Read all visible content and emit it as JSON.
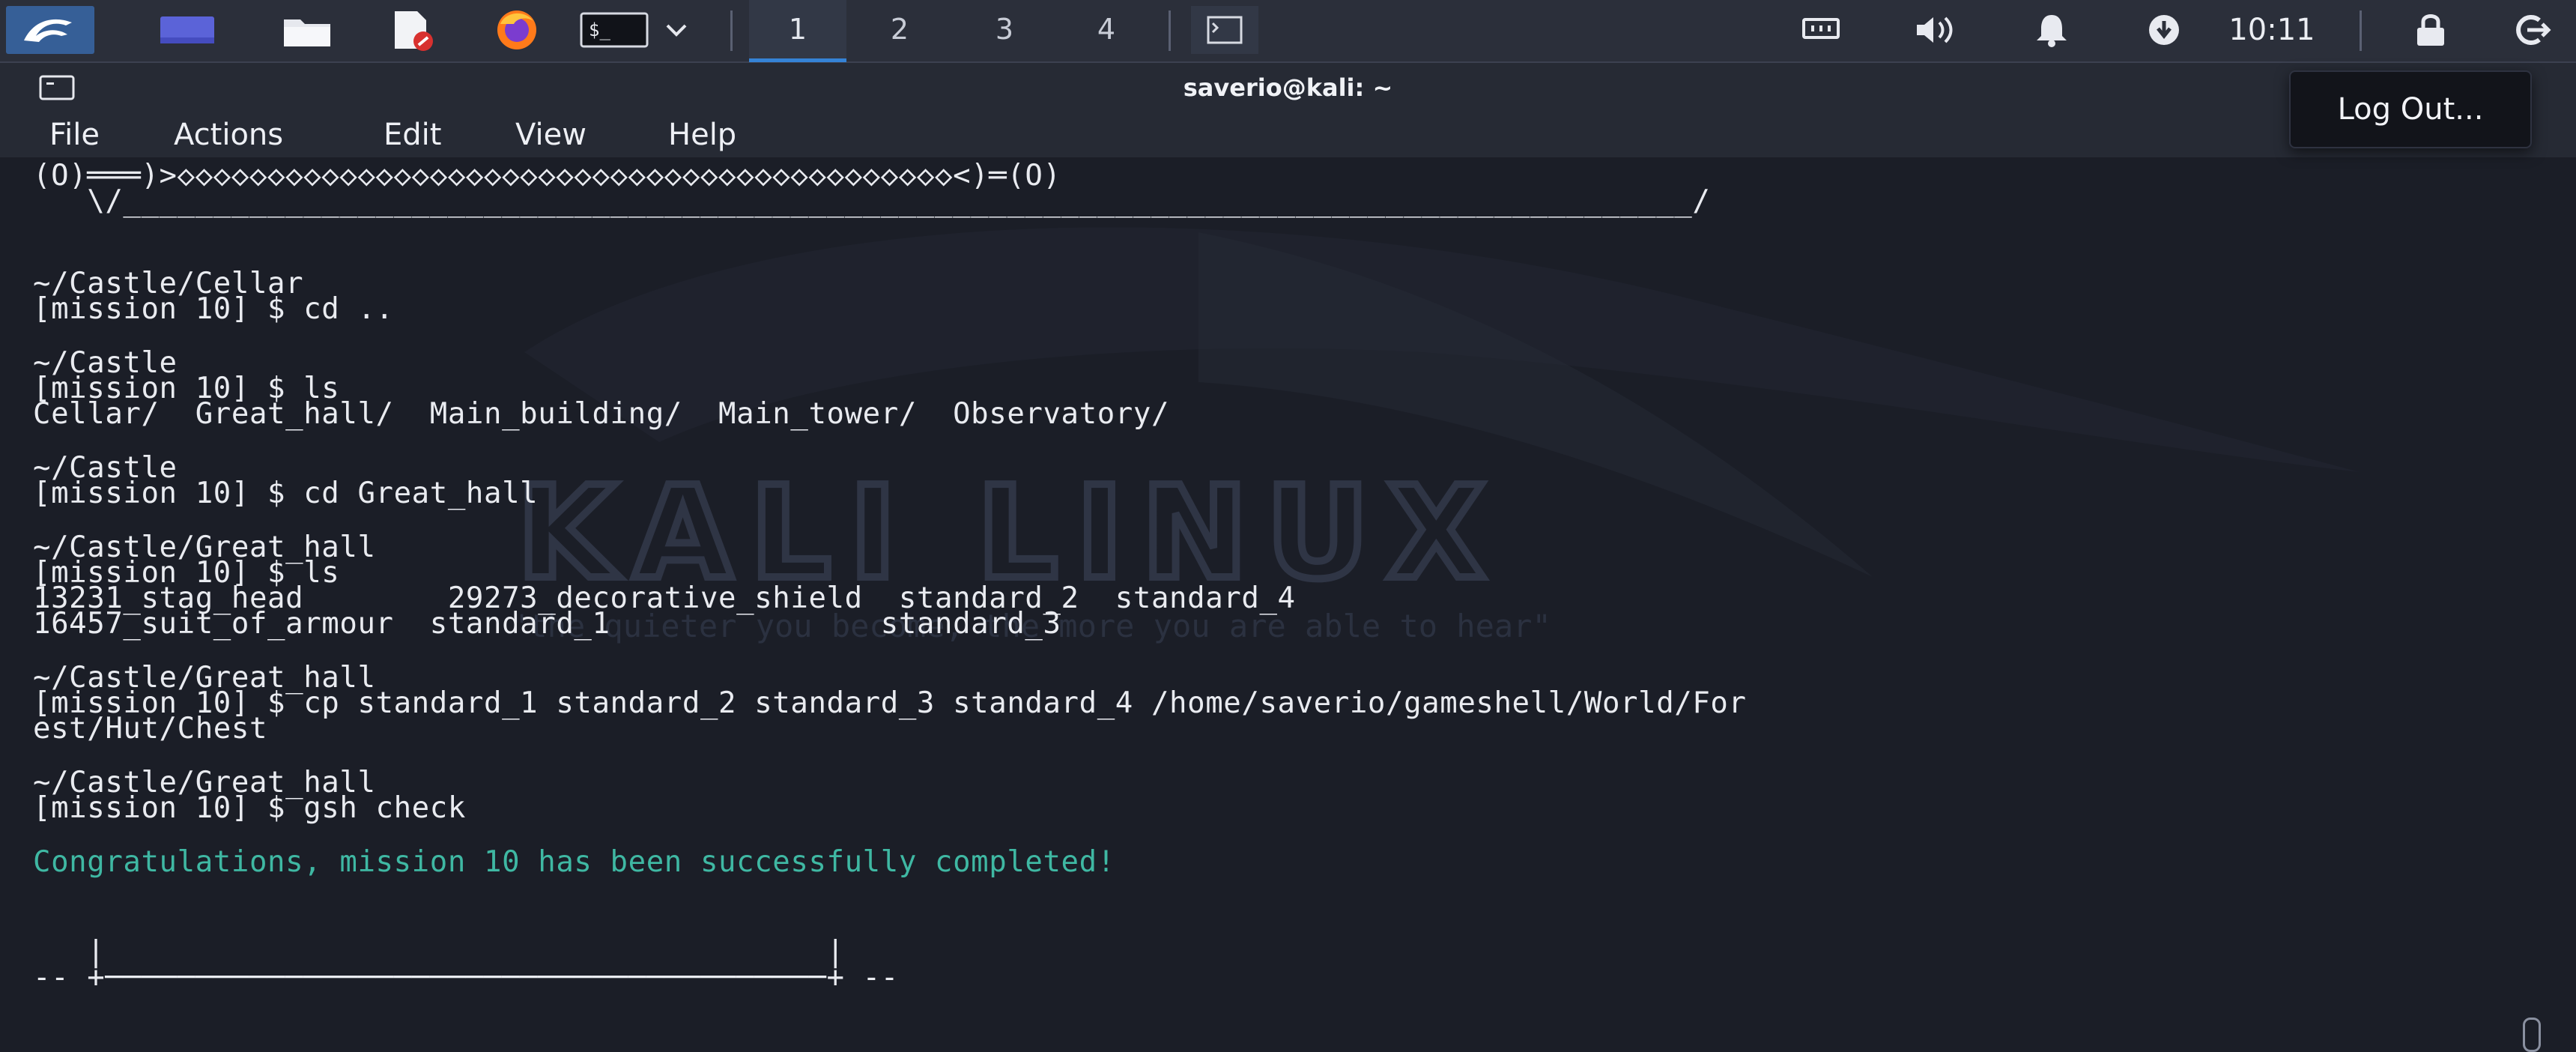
{
  "panel": {
    "workspaces": [
      "1",
      "2",
      "3",
      "4"
    ],
    "active_workspace": "1",
    "clock": "10:11"
  },
  "window": {
    "title": "saverio@kali: ~"
  },
  "menu": [
    "File",
    "Actions",
    "Edit",
    "View",
    "Help"
  ],
  "popup": {
    "logout_label": "Log Out..."
  },
  "background": {
    "logo_text": "KALI LINUX",
    "tagline": "\"the quieter you become, the more you are able to hear\""
  },
  "terminal": {
    "banner_top": "(O)═══)>◇◇◇◇◇◇◇◇◇◇◇◇◇◇◇◇◇◇◇◇◇◇◇◇◇◇◇◇◇◇◇◇◇◇◇◇◇◇◇◇◇◇◇<)═(O)",
    "banner_bottom": "   \\/_______________________________________________________________________________________/",
    "lines": [
      "~/Castle/Cellar",
      "[mission 10] $ cd ..",
      "~/Castle",
      "[mission 10] $ ls",
      "Cellar/  Great_hall/  Main_building/  Main_tower/  Observatory/",
      "~/Castle",
      "[mission 10] $ cd Great_hall",
      "~/Castle/Great_hall",
      "[mission 10] $ ls",
      "13231_stag_head        29273_decorative_shield  standard_2  standard_4",
      "16457_suit_of_armour  standard_1               standard_3",
      "~/Castle/Great_hall",
      "[mission 10] $ cp standard_1 standard_2 standard_3 standard_4 /home/saverio/gameshell/World/For",
      "est/Hut/Chest",
      "~/Castle/Great_hall",
      "[mission 10] $ gsh check",
      "Congratulations, mission 10 has been successfully completed!",
      "   |                                        |",
      "-- +────────────────────────────────────────+ --"
    ]
  },
  "colors": {
    "success": "#3fb8a3",
    "accent": "#3583d6"
  }
}
